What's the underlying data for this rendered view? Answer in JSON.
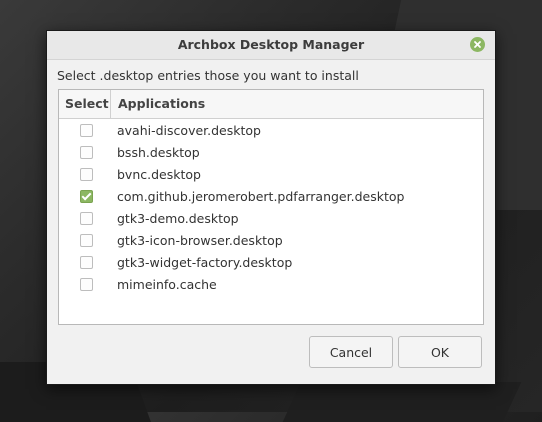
{
  "window": {
    "title": "Archbox Desktop Manager",
    "close_icon": "close-icon"
  },
  "prompt": "Select .desktop entries those you want to install",
  "table": {
    "headers": {
      "select": "Select",
      "applications": "Applications"
    },
    "rows": [
      {
        "checked": false,
        "name": "avahi-discover.desktop"
      },
      {
        "checked": false,
        "name": "bssh.desktop"
      },
      {
        "checked": false,
        "name": "bvnc.desktop"
      },
      {
        "checked": true,
        "name": "com.github.jeromerobert.pdfarranger.desktop"
      },
      {
        "checked": false,
        "name": "gtk3-demo.desktop"
      },
      {
        "checked": false,
        "name": "gtk3-icon-browser.desktop"
      },
      {
        "checked": false,
        "name": "gtk3-widget-factory.desktop"
      },
      {
        "checked": false,
        "name": "mimeinfo.cache"
      }
    ]
  },
  "buttons": {
    "cancel": "Cancel",
    "ok": "OK"
  },
  "colors": {
    "accent": "#8cb762",
    "dialog_bg": "#f1f1f1"
  }
}
